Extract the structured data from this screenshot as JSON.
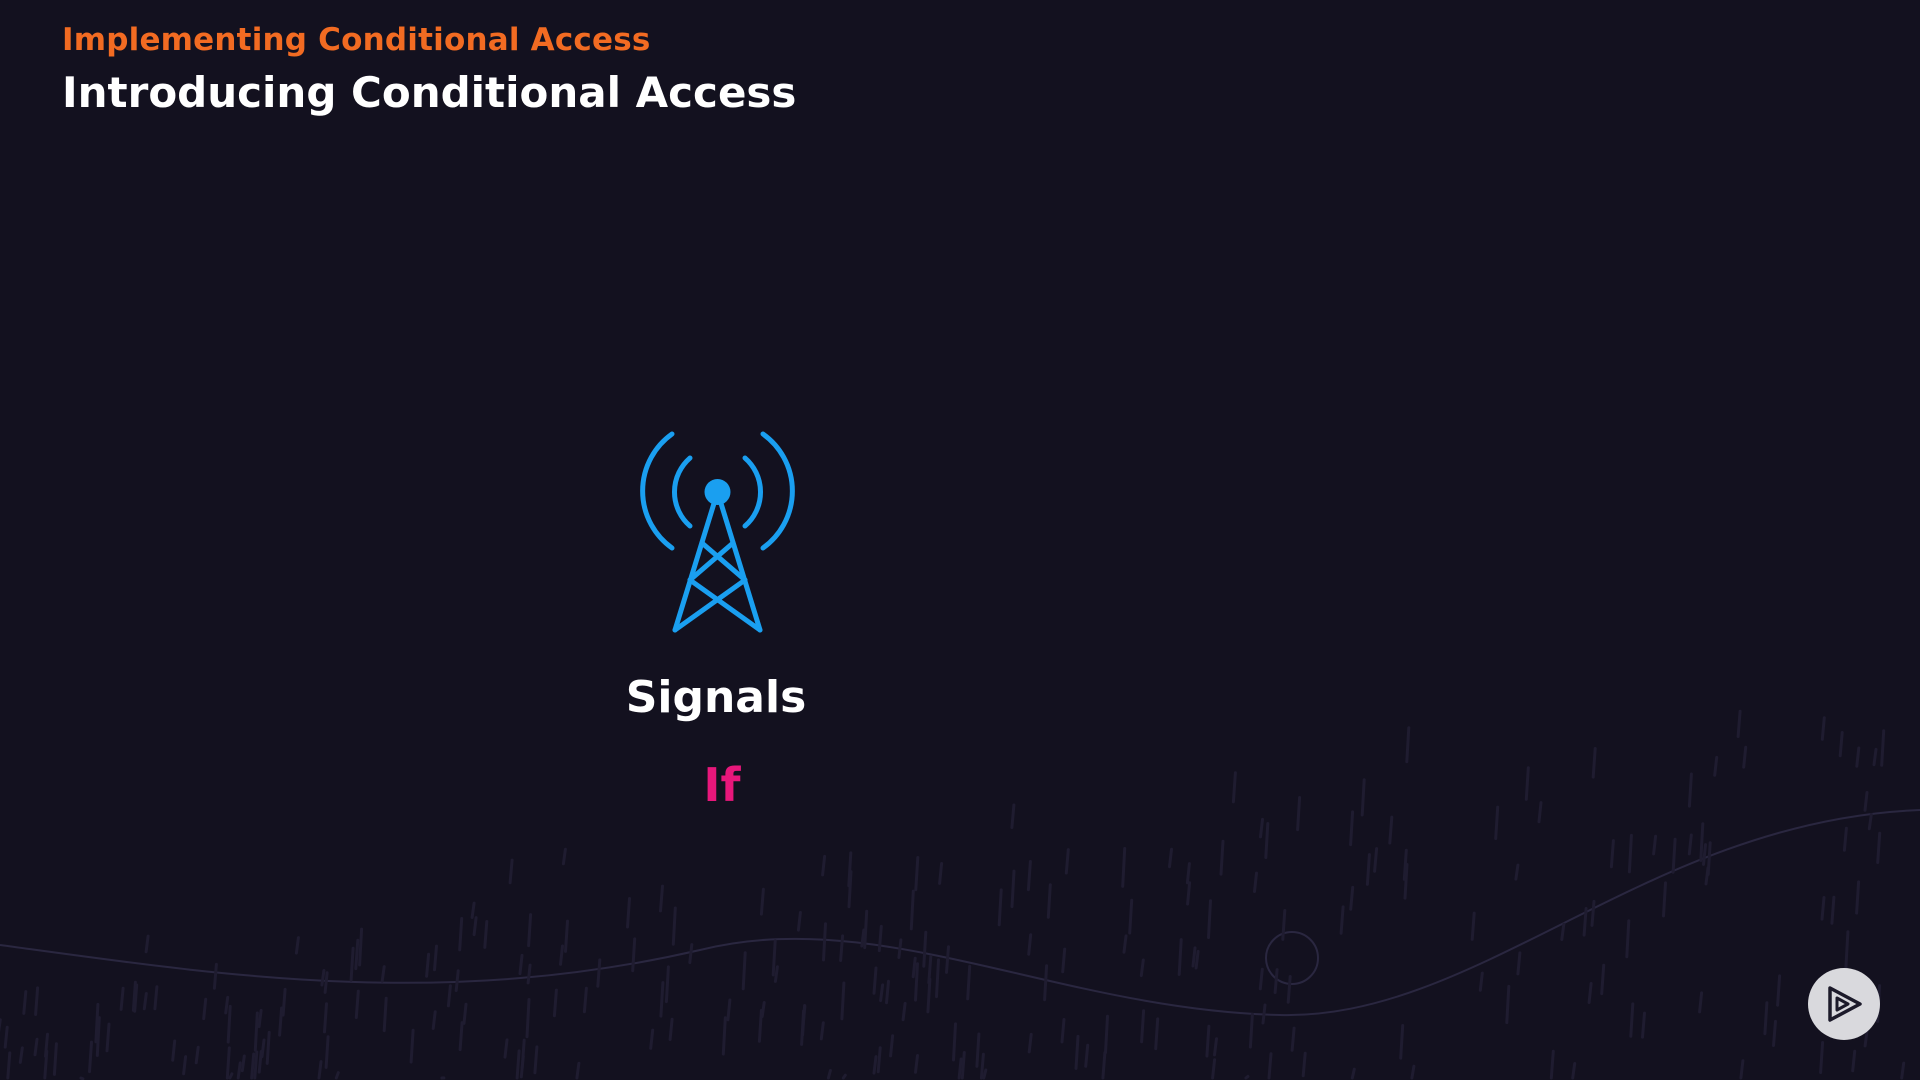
{
  "slide": {
    "course_title": "Implementing Conditional Access",
    "slide_title": "Introducing Conditional Access"
  },
  "content": {
    "signals_icon": "radio-tower-icon",
    "signals_label": "Signals",
    "if_label": "If"
  },
  "branding": {
    "logo_icon": "play-logo-icon"
  },
  "colors": {
    "background": "#13111f",
    "course_title": "#f26b22",
    "slide_title": "#ffffff",
    "icon": "#1a9ff0",
    "if_label": "#e8177b",
    "logo_background": "#d9d9dd"
  }
}
